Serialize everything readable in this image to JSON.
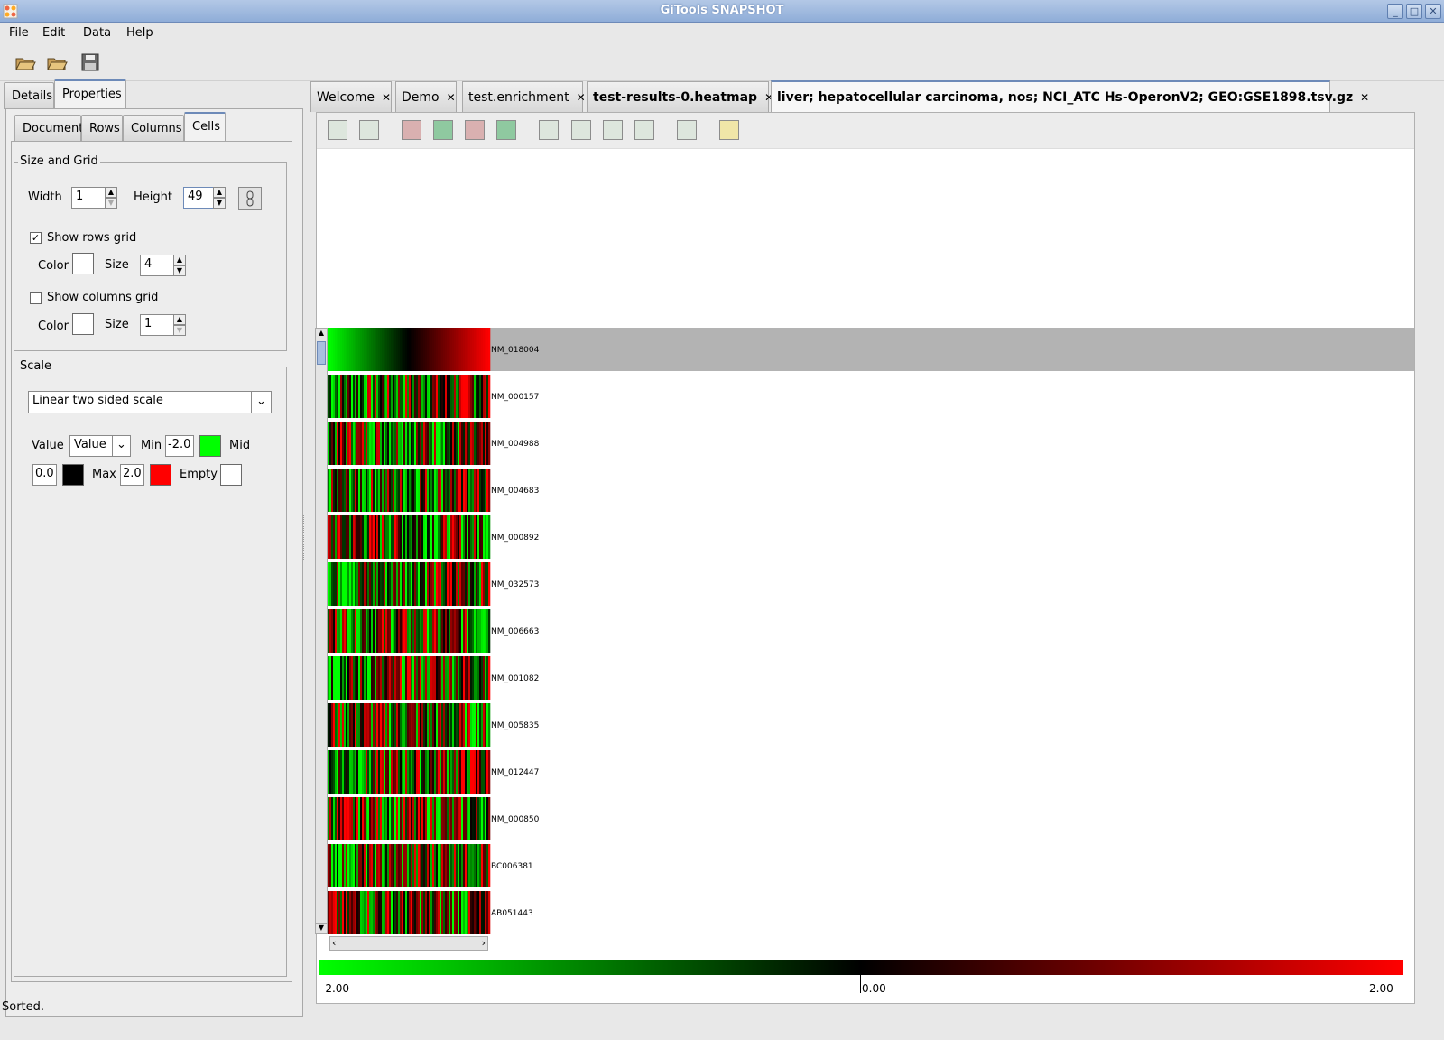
{
  "window": {
    "title": "GiTools SNAPSHOT",
    "minimize": "_",
    "maximize": "□",
    "close": "✕"
  },
  "menu": [
    "File",
    "Edit",
    "Data",
    "Help"
  ],
  "toolbar": {
    "open_icon": "folder-open-icon",
    "open2_icon": "folder-open-icon",
    "save_icon": "save-icon"
  },
  "left_tabs": [
    "Details",
    "Properties"
  ],
  "prop_tabs": [
    "Document",
    "Rows",
    "Columns",
    "Cells"
  ],
  "size_grid": {
    "legend": "Size and Grid",
    "width_label": "Width",
    "width_value": "1",
    "height_label": "Height",
    "height_value": "49",
    "show_rows_grid": "Show rows grid",
    "rows_color_label": "Color",
    "rows_size_label": "Size",
    "rows_size_value": "4",
    "show_columns_grid": "Show columns grid",
    "cols_color_label": "Color",
    "cols_size_label": "Size",
    "cols_size_value": "1",
    "rows_grid_checked": true,
    "columns_grid_checked": false
  },
  "scale": {
    "legend": "Scale",
    "type": "Linear two sided scale",
    "value_label": "Value",
    "value_select": "Value",
    "min_label": "Min",
    "min_value": "-2.0",
    "min_color": "#00ff00",
    "mid_label": "Mid",
    "mid_value": "0.0",
    "mid_color": "#000000",
    "max_label": "Max",
    "max_value": "2.0",
    "max_color": "#ff0000",
    "empty_label": "Empty",
    "empty_color": "#ffffff"
  },
  "doc_tabs": [
    {
      "label": "Welcome",
      "close": "✕"
    },
    {
      "label": "Demo",
      "close": "✕"
    },
    {
      "label": "test.enrichment",
      "close": "✕"
    },
    {
      "label": "test-results-0.heatmap",
      "close": "✕"
    },
    {
      "label": "liver; hepatocellular carcinoma, nos; NCI_ATC Hs-OperonV2; GEO:GSE1898.tsv.gz",
      "close": "✕"
    }
  ],
  "heatmap": {
    "rows": [
      "NM_018004",
      "NM_000157",
      "NM_004988",
      "NM_004683",
      "NM_000892",
      "NM_032573",
      "NM_006663",
      "NM_001082",
      "NM_005835",
      "NM_012447",
      "NM_000850",
      "BC006381",
      "AB051443"
    ],
    "selected_row": 0
  },
  "colorbar": {
    "min_label": "-2.00",
    "mid_label": "0.00",
    "max_label": "2.00",
    "min_color": "#00ff00",
    "mid_color": "#000000",
    "max_color": "#ff0000"
  },
  "status": "Sorted."
}
